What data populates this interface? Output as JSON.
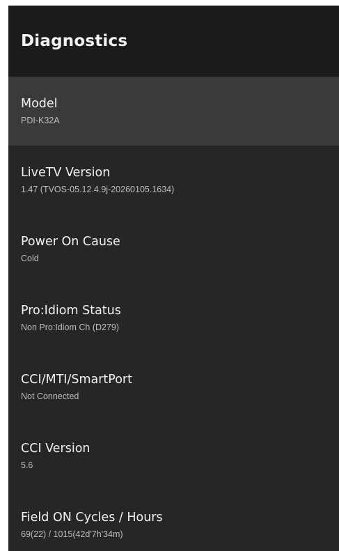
{
  "header": {
    "title": "Diagnostics"
  },
  "items": [
    {
      "label": "Model",
      "value": "PDI-K32A"
    },
    {
      "label": "LiveTV Version",
      "value": "1.47 (TVOS-05.12.4.9j-20260105.1634)"
    },
    {
      "label": "Power On Cause",
      "value": "Cold"
    },
    {
      "label": "Pro:Idiom Status",
      "value": "Non Pro:Idiom Ch (D279)"
    },
    {
      "label": "CCI/MTI/SmartPort",
      "value": "Not Connected"
    },
    {
      "label": "CCI Version",
      "value": "5.6"
    },
    {
      "label": "Field ON Cycles / Hours",
      "value": "69(22) / 1015(42d'7h'34m)"
    }
  ]
}
